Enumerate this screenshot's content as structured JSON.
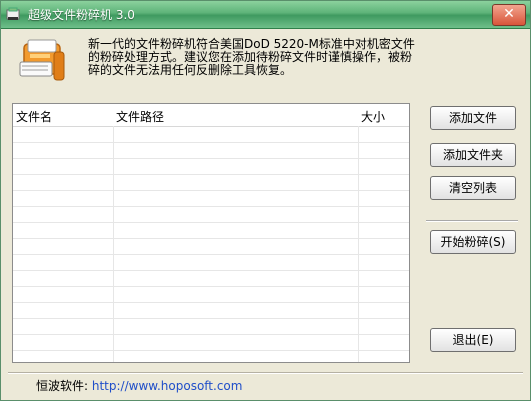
{
  "window": {
    "title": "超级文件粉碎机  3.0",
    "close_label": "✕"
  },
  "description": "新一代的文件粉碎机符合美国DoD 5220-M标准中对机密文件的粉碎处理方式。建议您在添加待粉碎文件时谨慎操作，被粉碎的文件无法用任何反删除工具恢复。",
  "table": {
    "columns": [
      "文件名",
      "文件路径",
      "大小"
    ],
    "rows": []
  },
  "buttons": {
    "add_file": "添加文件",
    "add_folder": "添加文件夹",
    "clear_list": "清空列表",
    "start_shred": "开始粉碎(S)",
    "exit": "退出(E)"
  },
  "footer": {
    "label": "恒波软件:",
    "url": "http://www.hoposoft.com"
  },
  "icons": [
    "window-icon",
    "shredder-icon",
    "close-icon"
  ]
}
